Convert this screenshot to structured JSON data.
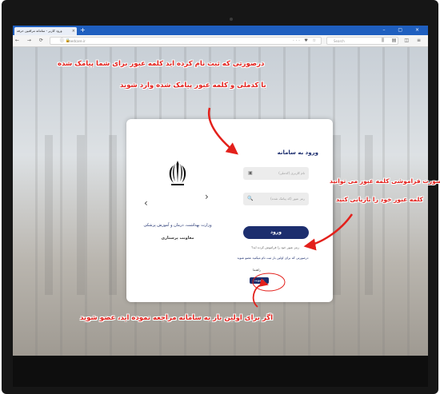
{
  "browser": {
    "tab_title": "ورود کاربر - سامانه مراقبین حرفه",
    "tab_close": "×",
    "new_tab": "+",
    "window_controls": "– ▢ ×",
    "nav_buttons": "← → ⟳ ⌂",
    "url_lock": "ⓘ 🔒",
    "url_host": "medcare.ir",
    "url_actions": "··· ♥ ☆",
    "search_placeholder": "Search",
    "toolbar_icons": "⫼ ▤ ◫ ≡"
  },
  "login_card": {
    "ministry": "وزارت بهداشت، درمان و آموزش پزشکی",
    "deputy": "معاونت پرستاری",
    "arrow_prev": "‹",
    "arrow_next": "›",
    "title": "ورود به سامانه",
    "username_placeholder": "نام کاربری (کدملی)",
    "password_placeholder": "رمز عبور (کد پیامک شده)",
    "username_icon": "▣",
    "password_icon": "🔍",
    "login_button": "ورود",
    "forgot_link": "رمز عبور خود را فراموش کرده اید؟",
    "register_note": "درصورتی که برای اولین بار ثبت نام میکنید عضو شوید",
    "help_label": "راهنما",
    "join_button": "عضویت"
  },
  "annotations": {
    "line1": "درصورتی که ثبت نام کرده اید کلمه عبور برای شما پیامک شده",
    "line2": "با کدملی و کلمه عبور پیامک شده وارد شوید",
    "line3": "درصورت فراموشی کلمه عبور می توانید",
    "line4": "کلمه عبور خود را بازیابی کنید",
    "line5": "اگر برای اولین بار به سامانه مراجعه نموده اید، عضو شوید",
    "color": "#e3201b"
  },
  "colors": {
    "brand": "#1c2e6e",
    "browser_tabbar": "#1f5fbf"
  }
}
